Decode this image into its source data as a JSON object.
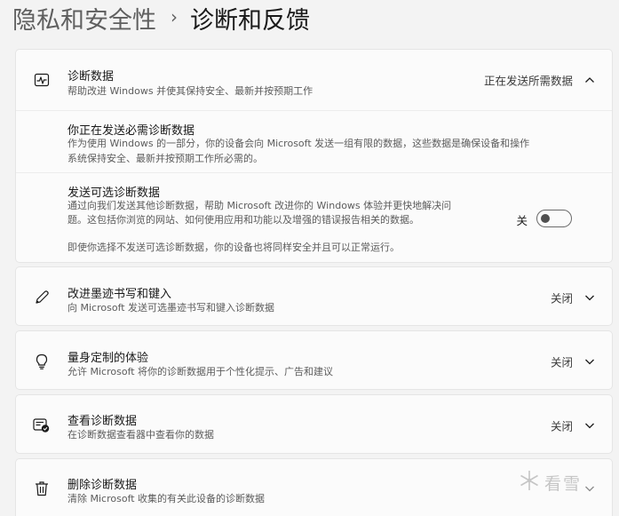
{
  "breadcrumb": {
    "parent": "隐私和安全性",
    "separator": "›",
    "current": "诊断和反馈"
  },
  "diagnostic_data": {
    "title": "诊断数据",
    "description": "帮助改进 Windows 并使其保持安全、最新并按预期工作",
    "status": "正在发送所需数据",
    "icon": "diagnostic-pulse-icon",
    "expanded": true,
    "required": {
      "title": "你正在发送必需诊断数据",
      "text_line1": "作为使用 Windows 的一部分，你的设备会向 Microsoft 发送一组有限的数据，这些数据是确保设备和操作",
      "text_line2": "系统保持安全、最新并按预期工作所必需的。"
    },
    "optional": {
      "title": "发送可选诊断数据",
      "text_line1": "通过向我们发送其他诊断数据，帮助 Microsoft 改进你的 Windows 体验并更快地解决问",
      "text_line2": "题。这包括你浏览的网站、如何使用应用和功能以及增强的错误报告相关的数据。",
      "toggle_label": "关",
      "toggle_on": false,
      "note": "即使你选择不发送可选诊断数据，你的设备也将同样安全并且可以正常运行。"
    }
  },
  "inking": {
    "title": "改进墨迹书写和键入",
    "description": "向 Microsoft 发送可选墨迹书写和键入诊断数据",
    "status": "关闭",
    "icon": "pen-icon"
  },
  "tailored": {
    "title": "量身定制的体验",
    "description": "允许 Microsoft 将你的诊断数据用于个性化提示、广告和建议",
    "status": "关闭",
    "icon": "lightbulb-icon"
  },
  "viewer": {
    "title": "查看诊断数据",
    "description": "在诊断数据查看器中查看你的数据",
    "status": "关闭",
    "icon": "data-viewer-icon"
  },
  "delete": {
    "title": "删除诊断数据",
    "description": "清除 Microsoft 收集的有关此设备的诊断数据",
    "icon": "trash-icon"
  },
  "watermark": {
    "text": "看雪"
  }
}
